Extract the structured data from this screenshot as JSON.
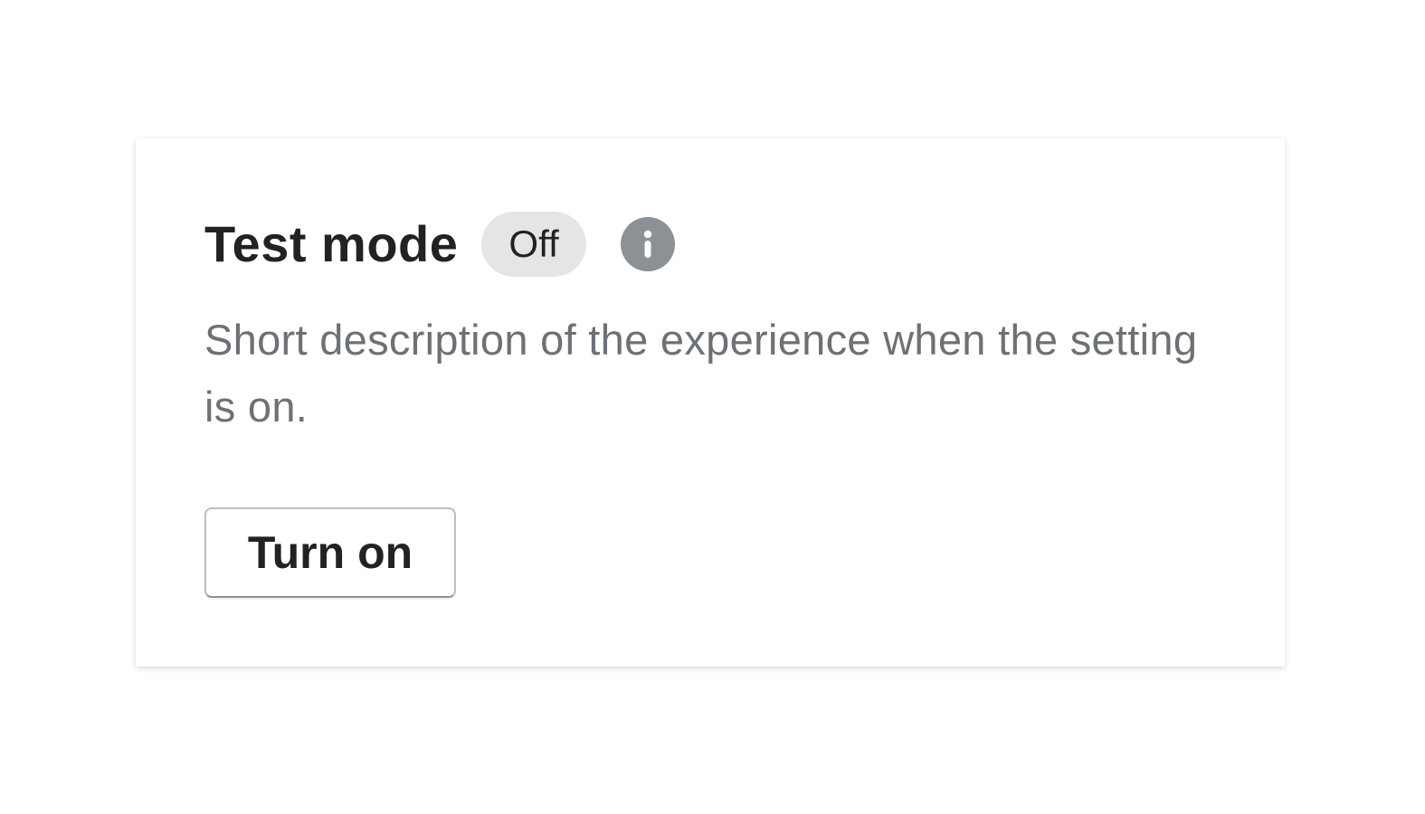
{
  "setting": {
    "title": "Test mode",
    "status_badge": "Off",
    "info_icon": "info-icon",
    "description": "Short description of the experience when the setting is on.",
    "action_label": "Turn on"
  },
  "colors": {
    "title": "#202223",
    "description": "#6d7175",
    "badge_background": "#e4e5e7",
    "info_icon_background": "#8c9196",
    "button_border": "#babfc3"
  }
}
